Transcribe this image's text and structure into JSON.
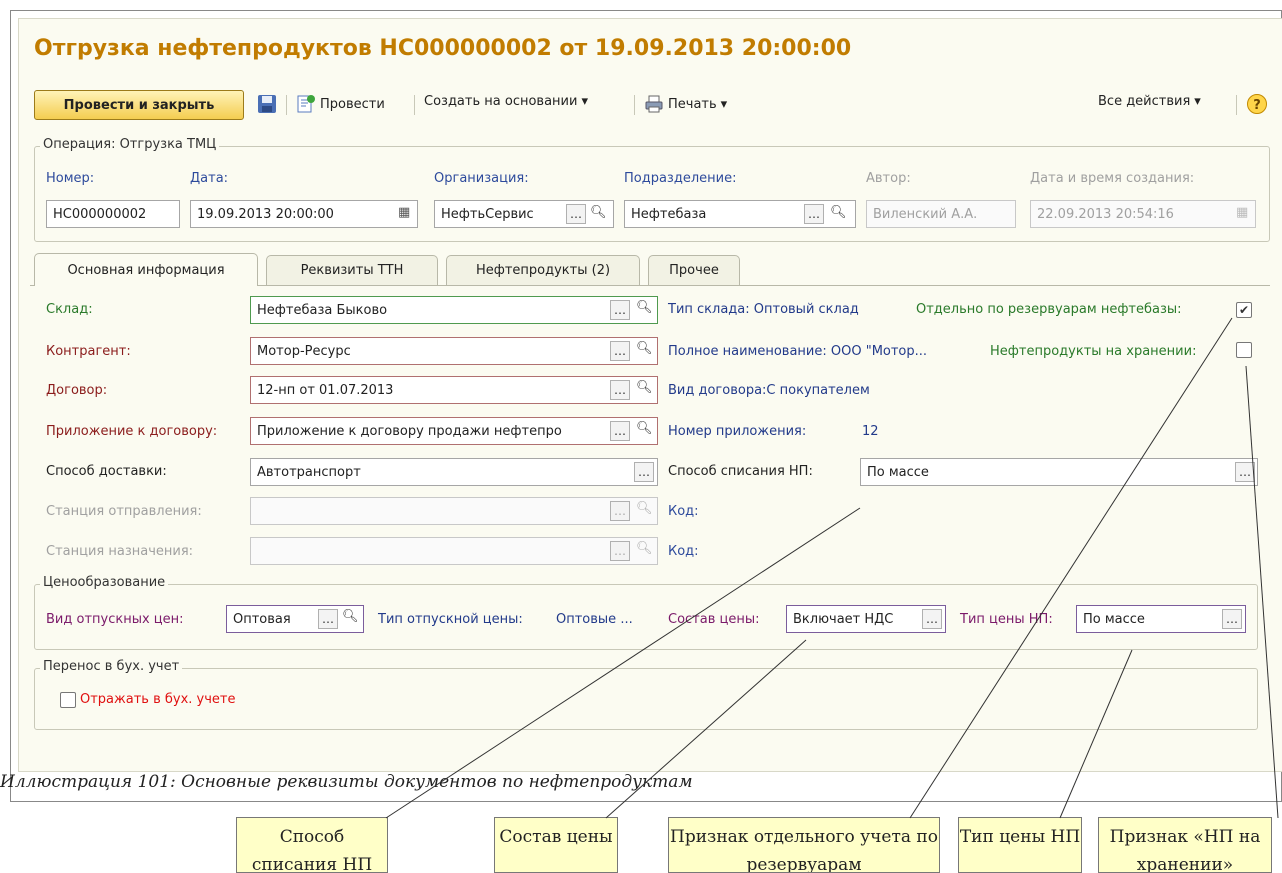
{
  "window": {
    "title": "Отгрузка нефтепродуктов НС000000002 от 19.09.2013 20:00:00"
  },
  "toolbar": {
    "post_close": "Провести и закрыть",
    "post": "Провести",
    "create_based": "Создать на основании",
    "print": "Печать",
    "all_actions": "Все действия"
  },
  "operation": {
    "group_title": "Операция: Отгрузка ТМЦ",
    "number_label": "Номер:",
    "number_value": "НС000000002",
    "date_label": "Дата:",
    "date_value": "19.09.2013 20:00:00",
    "org_label": "Организация:",
    "org_value": "НефтьСервис",
    "dept_label": "Подразделение:",
    "dept_value": "Нефтебаза",
    "author_label": "Автор:",
    "author_value": "Виленский А.А.",
    "created_label": "Дата и время создания:",
    "created_value": "22.09.2013 20:54:16"
  },
  "tabs": [
    {
      "label": "Основная информация"
    },
    {
      "label": "Реквизиты ТТН"
    },
    {
      "label": "Нефтепродукты (2)"
    },
    {
      "label": "Прочее"
    }
  ],
  "main": {
    "warehouse_label": "Склад:",
    "warehouse_value": "Нефтебаза Быково",
    "warehouse_type": "Тип склада: Оптовый склад",
    "separate_label": "Отдельно по резервуарам нефтебазы:",
    "separate_checked": true,
    "counterparty_label": "Контрагент:",
    "counterparty_value": "Мотор-Ресурс",
    "full_name": "Полное наименование: ООО \"Мотор...",
    "storage_label": "Нефтепродукты на хранении:",
    "storage_checked": false,
    "contract_label": "Договор:",
    "contract_value": "12-нп от 01.07.2013",
    "contract_kind": "Вид договора:С покупателем",
    "appendix_label": "Приложение к договору:",
    "appendix_value": "Приложение к договору продажи нефтепро",
    "appendix_number_label": "Номер приложения:",
    "appendix_number_value": "12",
    "delivery_label": "Способ доставки:",
    "delivery_value": "Автотранспорт",
    "writeoff_label": "Способ списания НП:",
    "writeoff_value": "По массе",
    "dep_station_label": "Станция отправления:",
    "dest_station_label": "Станция назначения:",
    "code_label_1": "Код:",
    "code_label_2": "Код:"
  },
  "pricing": {
    "group_title": "Ценообразование",
    "kind_label": "Вид отпускных цен:",
    "kind_value": "Оптовая",
    "type_label": "Тип отпускной цены:",
    "type_value": "Оптовые ...",
    "composition_label": "Состав цены:",
    "composition_value": "Включает НДС",
    "np_type_label": "Тип цены НП:",
    "np_type_value": "По массе"
  },
  "accounting": {
    "group_title": "Перенос в бух. учет",
    "reflect_label": "Отражать в бух. учете",
    "reflect_checked": false
  },
  "caption": "Иллюстрация 101: Основные реквизиты документов по нефтепродуктам",
  "callouts": [
    {
      "text": "Способ списания НП"
    },
    {
      "text": "Состав цены"
    },
    {
      "text": "Признак отдельного учета по резервуарам"
    },
    {
      "text": "Тип цены НП"
    },
    {
      "text": "Признак «НП на хранении»"
    }
  ],
  "colors": {
    "title": "#c17c00",
    "group_bg": "#fbfbf1",
    "callout_bg": "#ffffc8",
    "primary_btn": "#f4cd50"
  }
}
